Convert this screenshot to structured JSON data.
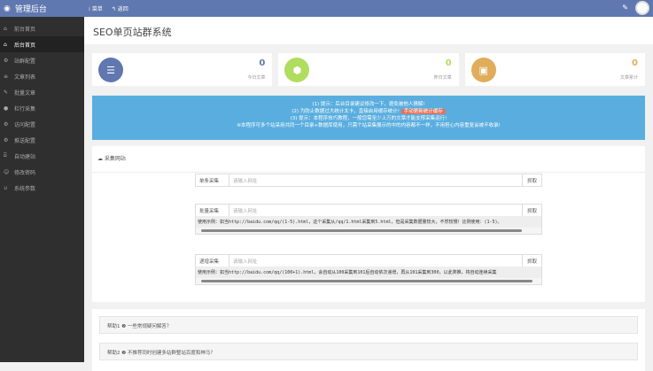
{
  "topbar": {
    "brand": "管理后台",
    "menu": "菜单",
    "back": "返回"
  },
  "sidebar": {
    "items": [
      {
        "label": "前台首页",
        "icon": "home-icon"
      },
      {
        "label": "后台首页",
        "icon": "home-icon"
      },
      {
        "label": "站群配置",
        "icon": "gear-icon"
      },
      {
        "label": "文章列表",
        "icon": "list-icon"
      },
      {
        "label": "批量文章",
        "icon": "edit-icon"
      },
      {
        "label": "栏行采集",
        "icon": "dot-icon"
      },
      {
        "label": "访问配置",
        "icon": "gear-icon"
      },
      {
        "label": "推送配置",
        "icon": "gear-icon"
      },
      {
        "label": "自动建站",
        "icon": "bank-icon"
      },
      {
        "label": "修改密码",
        "icon": "user-icon"
      },
      {
        "label": "系统参数",
        "icon": "magnet-icon"
      }
    ]
  },
  "page_title": "SEO单页站群系统",
  "stats": [
    {
      "value": "0",
      "label": "今日文章",
      "color": "#6077b0"
    },
    {
      "value": "0",
      "label": "昨日文章",
      "color": "#b0dd5e"
    },
    {
      "value": "0",
      "label": "文章累计",
      "color": "#e0ad5a"
    }
  ],
  "notice": {
    "line1": "(1) 提示：后台目录建议修改一下，避免被他人猜解!",
    "line2": "(2) 为防止数据过大统计太卡，直接启用缓存统计!",
    "badge": "手动更新统计缓存",
    "line3": "(3) 提示：本程序技巧教程，一般您需至少上万的文章才能支撑采集运行!",
    "line4": "④本程序可多个站采用共同一个目录+数据库使用，只需个站采集展示的中的内容都不一样，不用担心内容重复会被不收录!"
  },
  "collect": {
    "title": "采集网站",
    "single": {
      "label": "单条采集",
      "placeholder": "请输入网址",
      "button": "抓取"
    },
    "batch": {
      "label": "批量采集",
      "placeholder": "请输入网址",
      "button": "抓取",
      "example": "使用示例：如当http://baidu.com/qq/(1-5).html，这个采集从/qq/1.html采集到5.html，但是采集数据量较大，不然较慢！比例使用：(1-5)。"
    },
    "auto": {
      "label": "递增采集",
      "placeholder": "请输入网址",
      "button": "抓取",
      "example": "使用示例：如当http://baidu.com/qq/(100+1).html，会自动从100采集到101后自动依次递增，再从101采集到300，以此类推，将自动连续采集"
    }
  },
  "help": [
    {
      "label": "帮助1 ❷ 一些常规疑问解答？"
    },
    {
      "label": "帮助2 ❷ 不推荐同时创建多站群整站百度和神马？"
    }
  ]
}
